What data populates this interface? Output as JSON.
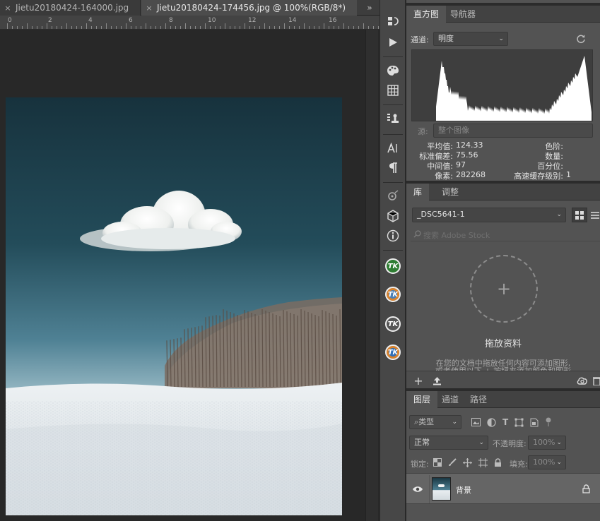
{
  "tabs": {
    "tab1_label": "Jietu20180424-164000.jpg",
    "tab2_label": "Jietu20180424-174456.jpg @ 100%(RGB/8*)",
    "close_glyph": "×",
    "more_glyph": "»"
  },
  "ruler": {
    "labels": [
      "0",
      "2",
      "4",
      "6",
      "8",
      "10",
      "12",
      "14",
      "16"
    ]
  },
  "histogram": {
    "tab_label": "直方图",
    "nav_tab_label": "导航器",
    "channel_label": "通道:",
    "channel_value": "明度",
    "source_label": "源:",
    "source_value": "整个图像",
    "mean_label": "平均值:",
    "mean_value": "124.33",
    "std_label": "标准偏差:",
    "std_value": "75.56",
    "median_label": "中间值:",
    "median_value": "97",
    "pixels_label": "像素:",
    "pixels_value": "282268",
    "level_label": "色阶:",
    "count_label": "数量:",
    "percentile_label": "百分位:",
    "cache_label": "高速缓存级别:",
    "cache_value": "1"
  },
  "library": {
    "tab_label": "库",
    "adjust_tab_label": "调整",
    "library_select": "_DSC5641-1",
    "search_placeholder": "搜索 Adobe Stock",
    "drop_title": "拖放资料",
    "drop_desc_line1": "在您的文档中拖放任何内容可添加图形,",
    "drop_desc_line2": "或者使用以下 + 按钮来添加颜色和图形"
  },
  "layers": {
    "tab_label": "图层",
    "channels_tab_label": "通道",
    "paths_tab_label": "路径",
    "filter_kind": "类型",
    "blend_mode": "正常",
    "opacity_label": "不透明度:",
    "opacity_value": "100%",
    "lock_label": "锁定:",
    "fill_label": "填充:",
    "fill_value": "100%",
    "layer_name": "背景"
  },
  "tools": {
    "tk_label": "TK"
  }
}
